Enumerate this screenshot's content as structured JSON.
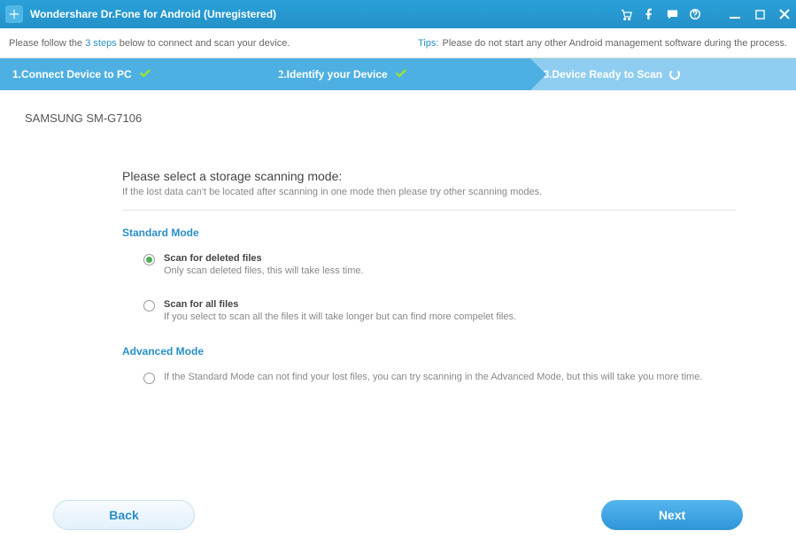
{
  "titlebar": {
    "title": "Wondershare Dr.Fone for Android (Unregistered)"
  },
  "infobar": {
    "left_prefix": "Please follow the ",
    "left_highlight": "3 steps",
    "left_suffix": " below to connect and scan your device.",
    "tips_label": "Tips:",
    "tips_text": "Please do not start any other Android management software during the process."
  },
  "steps": {
    "s1": "1.Connect Device to PC",
    "s2": "2.Identify your Device",
    "s3": "3.Device Ready to Scan"
  },
  "device_name": "SAMSUNG SM-G7106",
  "heading": "Please select a storage scanning mode:",
  "subheading": "If the lost data can't be located after scanning in one mode then please try other scanning modes.",
  "standard": {
    "title": "Standard Mode",
    "opt1_title": "Scan for deleted files",
    "opt1_desc": "Only scan deleted files, this will take less time.",
    "opt2_title": "Scan for all files",
    "opt2_desc": "If you select to scan all the files it will take longer but can find more compelet files."
  },
  "advanced": {
    "title": "Advanced Mode",
    "opt_desc": "If the Standard Mode can not find your lost files, you can try scanning in the Advanced Mode, but this will take you more time."
  },
  "buttons": {
    "back": "Back",
    "next": "Next"
  }
}
